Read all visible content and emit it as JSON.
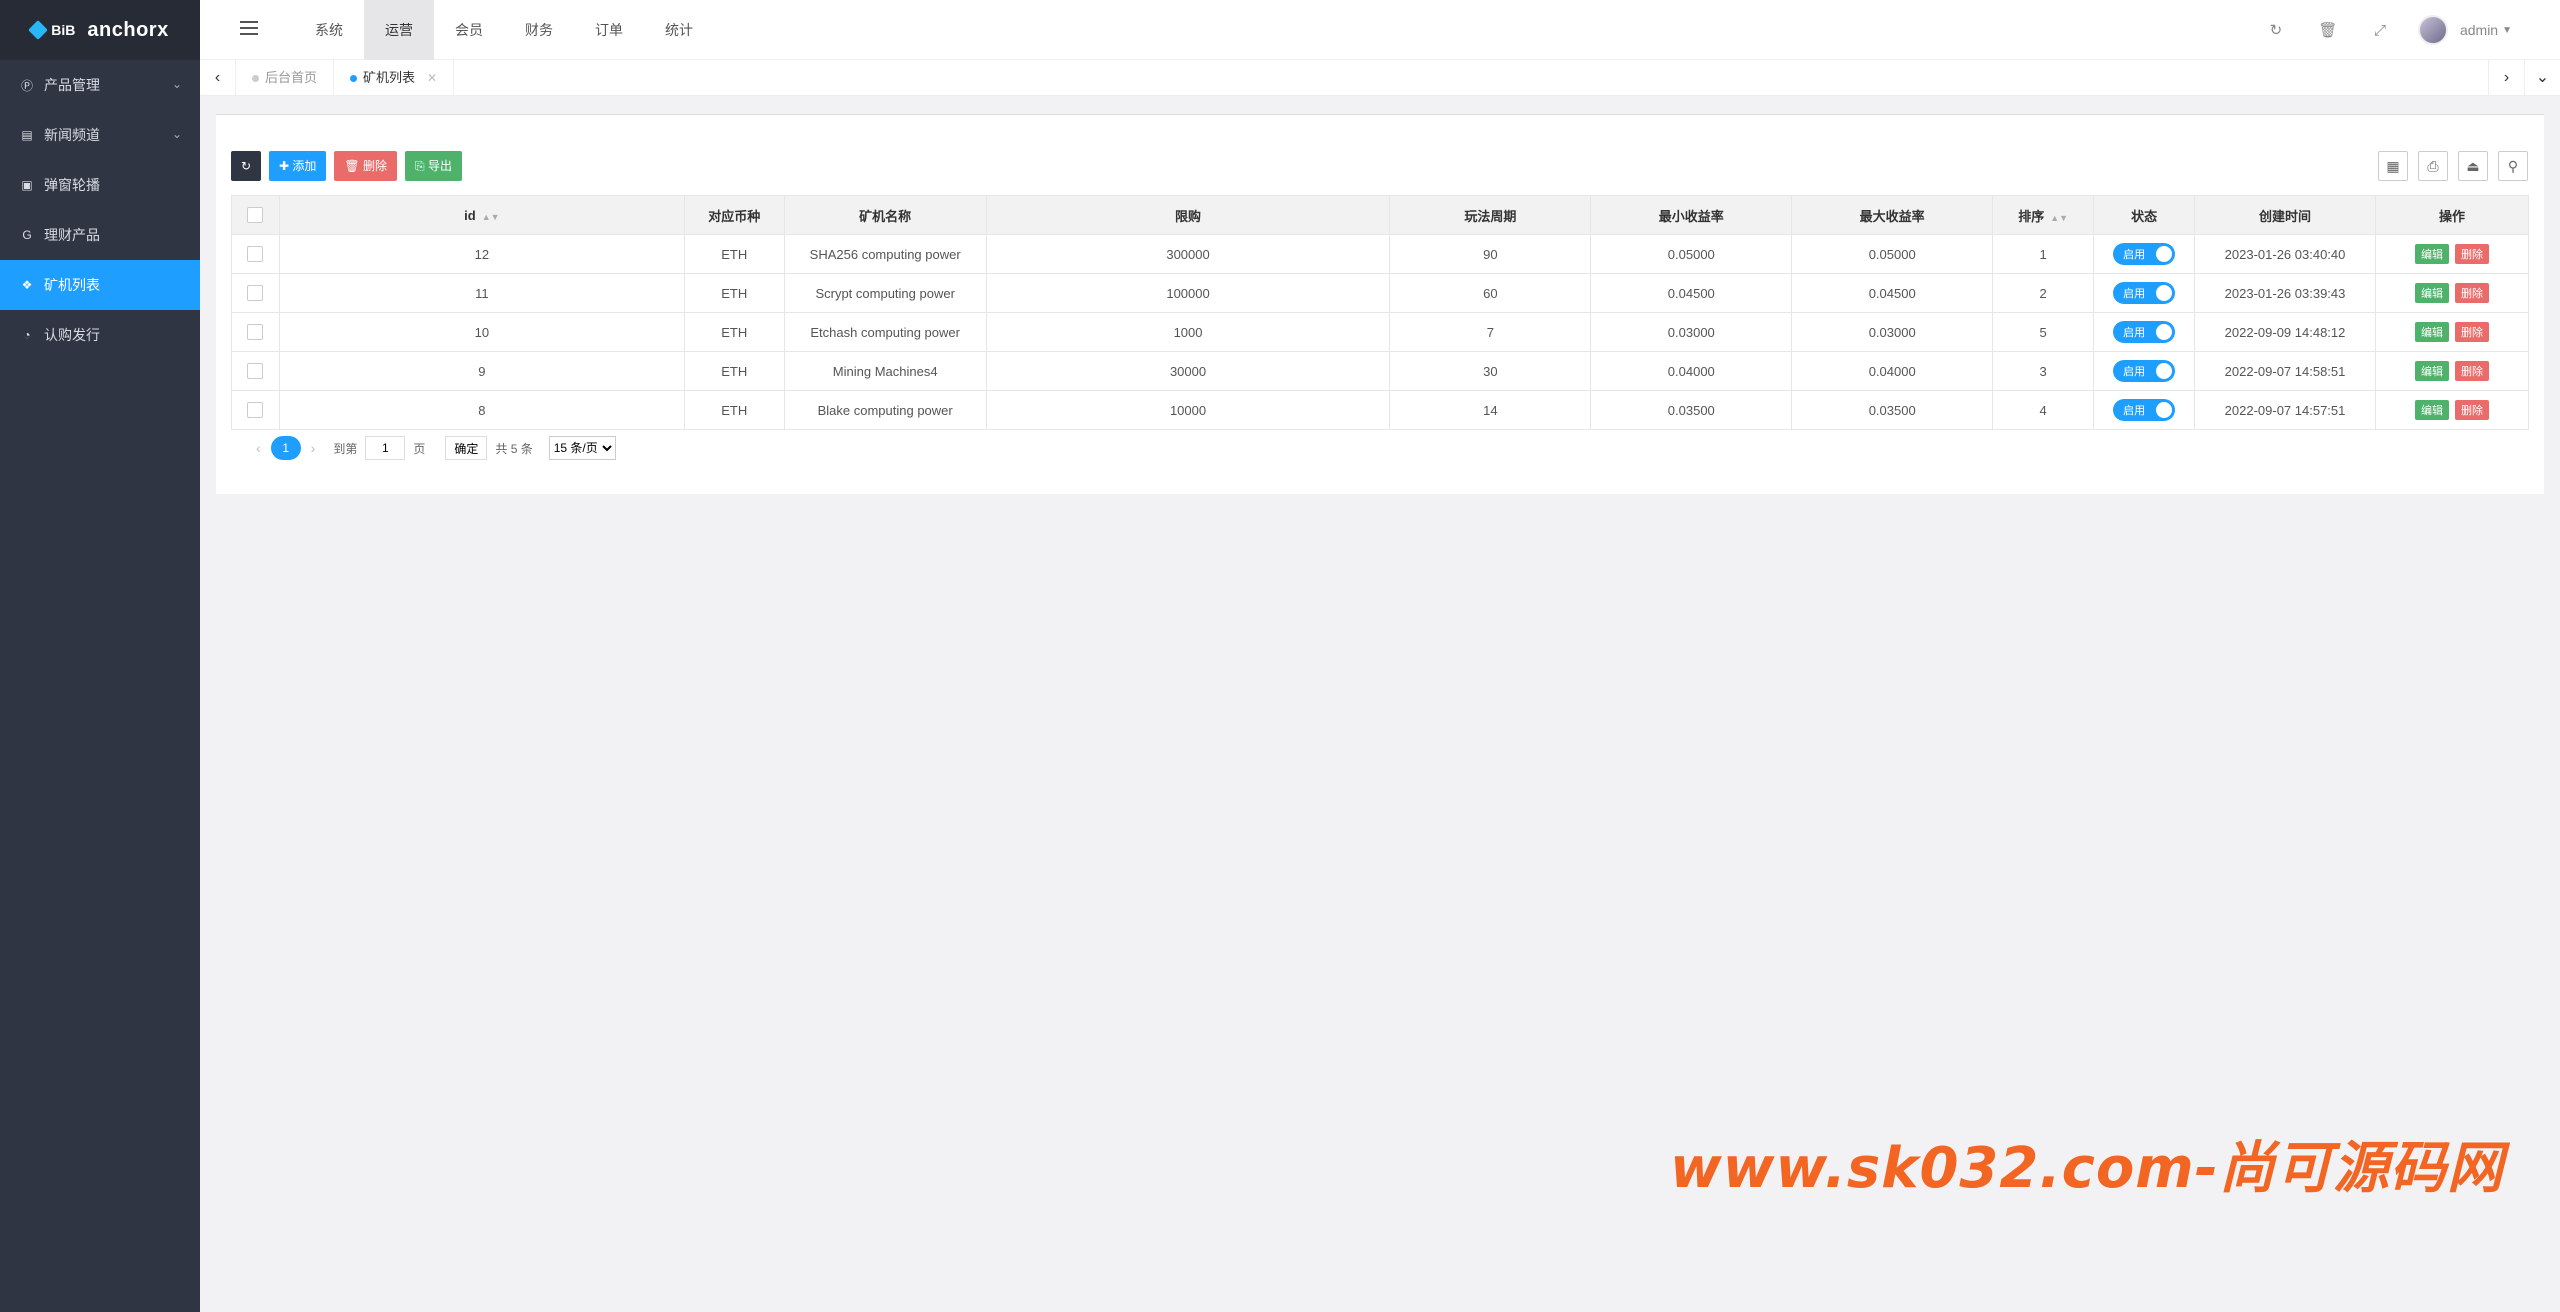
{
  "brand": {
    "logo_mark": "BiB",
    "name": "anchorx"
  },
  "sidebar": {
    "items": [
      {
        "label": "产品管理",
        "icon": "p-circle-icon",
        "expandable": true
      },
      {
        "label": "新闻频道",
        "icon": "newspaper-icon",
        "expandable": true
      },
      {
        "label": "弹窗轮播",
        "icon": "slides-icon",
        "expandable": false
      },
      {
        "label": "理财产品",
        "icon": "g-icon",
        "expandable": false
      },
      {
        "label": "矿机列表",
        "icon": "cubes-icon",
        "expandable": false,
        "active": true
      },
      {
        "label": "认购发行",
        "icon": "pie-chart-icon",
        "expandable": false
      }
    ]
  },
  "topnav": {
    "items": [
      "系统",
      "运营",
      "会员",
      "财务",
      "订单",
      "统计"
    ],
    "active": "运营"
  },
  "user": {
    "name": "admin"
  },
  "tabs": [
    {
      "label": "后台首页",
      "active": false
    },
    {
      "label": "矿机列表",
      "active": true
    }
  ],
  "toolbar": {
    "add_label": "添加",
    "delete_label": "删除",
    "export_label": "导出"
  },
  "table": {
    "headers": [
      "id",
      "对应币种",
      "矿机名称",
      "限购",
      "玩法周期",
      "最小收益率",
      "最大收益率",
      "排序",
      "状态",
      "创建时间",
      "操作"
    ],
    "rows": [
      [
        "12",
        "ETH",
        "SHA256 computing power",
        "300000",
        "90",
        "0.05000",
        "0.05000",
        "1",
        "启用",
        "2023-01-26 03:40:40"
      ],
      [
        "11",
        "ETH",
        "Scrypt computing power",
        "100000",
        "60",
        "0.04500",
        "0.04500",
        "2",
        "启用",
        "2023-01-26 03:39:43"
      ],
      [
        "10",
        "ETH",
        "Etchash computing power",
        "1000",
        "7",
        "0.03000",
        "0.03000",
        "5",
        "启用",
        "2022-09-09 14:48:12"
      ],
      [
        "9",
        "ETH",
        "Mining Machines4",
        "30000",
        "30",
        "0.04000",
        "0.04000",
        "3",
        "启用",
        "2022-09-07 14:58:51"
      ],
      [
        "8",
        "ETH",
        "Blake computing power",
        "10000",
        "14",
        "0.03500",
        "0.03500",
        "4",
        "启用",
        "2022-09-07 14:57:51"
      ]
    ],
    "edit_label": "编辑",
    "delete_label": "删除"
  },
  "pager": {
    "current": "1",
    "goto_label": "到第",
    "goto_value": "1",
    "page_label": "页",
    "confirm_label": "确定",
    "total_label": "共 5 条",
    "per_page": "15 条/页"
  },
  "watermark": "www.sk032.com-尚可源码网",
  "colors": {
    "sidebar_bg": "#2f3542",
    "accent": "#1e9fff",
    "danger": "#ea6c6a",
    "success": "#4fb26b",
    "watermark": "#f26522"
  }
}
